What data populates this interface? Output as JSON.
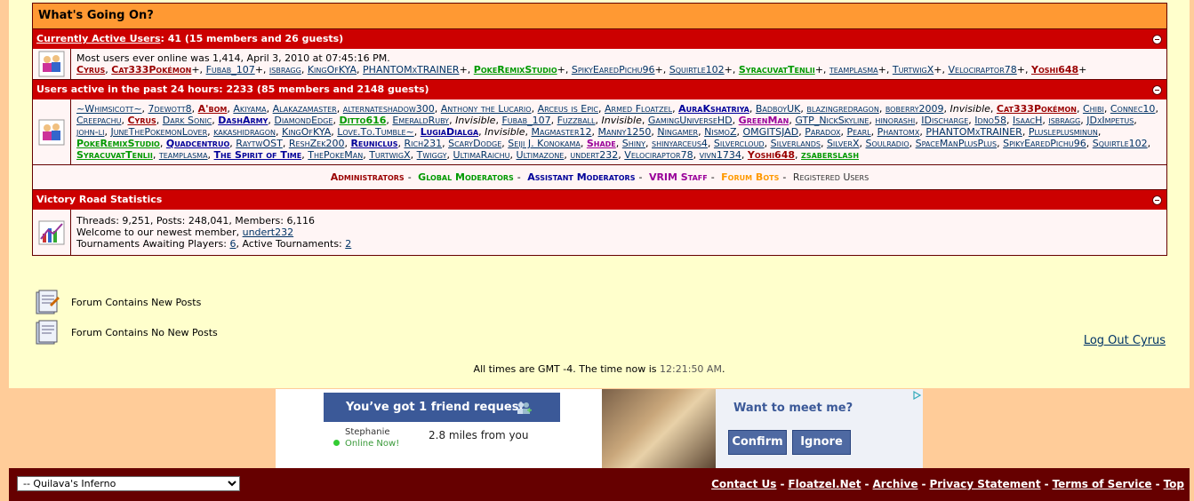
{
  "box_title": "What's Going On?",
  "active": {
    "heading_link": "Currently Active Users",
    "heading_rest": ": 41 (15 members and 26 guests)",
    "most_online": "Most users ever online was 1,414, April 3, 2010 at 07:45:16 PM.",
    "users": [
      {
        "name": "Cyrus",
        "cls": "u-red",
        "plus": ","
      },
      {
        "name": "Cat333Pokémon",
        "cls": "u-red",
        "plus": "+,"
      },
      {
        "name": "Fubab_107",
        "cls": "",
        "plus": "+,"
      },
      {
        "name": "isbragg",
        "cls": "",
        "plus": ","
      },
      {
        "name": "KingOfKYA",
        "cls": "",
        "plus": ","
      },
      {
        "name": "PHANTOMxTRAINER",
        "cls": "",
        "plus": "+,"
      },
      {
        "name": "PokeRemixStudio",
        "cls": "u-green",
        "plus": "+,"
      },
      {
        "name": "SpikyEaredPichu96",
        "cls": "",
        "plus": "+,"
      },
      {
        "name": "Squirtle102",
        "cls": "",
        "plus": "+,"
      },
      {
        "name": "SyracuvatTenlii",
        "cls": "u-green",
        "plus": "+,"
      },
      {
        "name": "teamplasma",
        "cls": "",
        "plus": "+,"
      },
      {
        "name": "TurtwigX",
        "cls": "",
        "plus": "+,"
      },
      {
        "name": "Velociraptor78",
        "cls": "",
        "plus": "+,"
      },
      {
        "name": "Yoshi648",
        "cls": "u-red",
        "plus": "+"
      }
    ]
  },
  "past24": {
    "heading": "Users active in the past 24 hours: 2233 (85 members and 2148 guests)",
    "users": [
      {
        "name": "~Whimsicott~",
        "cls": ""
      },
      {
        "name": "7dewott8",
        "cls": ""
      },
      {
        "name": "A'bom",
        "cls": "u-red"
      },
      {
        "name": "Akiyama",
        "cls": ""
      },
      {
        "name": "Alakazamaster",
        "cls": ""
      },
      {
        "name": "alternateshadow300",
        "cls": ""
      },
      {
        "name": "Anthony the Lucario",
        "cls": ""
      },
      {
        "name": "Arceus is Epic",
        "cls": ""
      },
      {
        "name": "Armed Floatzel",
        "cls": ""
      },
      {
        "name": "AuraKshatriya",
        "cls": "u-blue"
      },
      {
        "name": "BadboyUK",
        "cls": ""
      },
      {
        "name": "blazingredragon",
        "cls": ""
      },
      {
        "name": "boberry2009",
        "cls": ""
      },
      {
        "name": "Invisible",
        "cls": "inv"
      },
      {
        "name": "Cat333Pokémon",
        "cls": "u-red"
      },
      {
        "name": "Chibi",
        "cls": ""
      },
      {
        "name": "Connec10",
        "cls": ""
      },
      {
        "name": "Creepachu",
        "cls": ""
      },
      {
        "name": "Cyrus",
        "cls": "u-red"
      },
      {
        "name": "Dark Sonic",
        "cls": ""
      },
      {
        "name": "DashArmy",
        "cls": "u-blue"
      },
      {
        "name": "DiamondEdge",
        "cls": ""
      },
      {
        "name": "Ditto616",
        "cls": "u-green"
      },
      {
        "name": "EmeraldRuby",
        "cls": ""
      },
      {
        "name": "Invisible",
        "cls": "inv"
      },
      {
        "name": "Fubab_107",
        "cls": ""
      },
      {
        "name": "Fuzzball",
        "cls": ""
      },
      {
        "name": "Invisible",
        "cls": "inv"
      },
      {
        "name": "GamingUniverseHD",
        "cls": ""
      },
      {
        "name": "GreenMan",
        "cls": "u-purple"
      },
      {
        "name": "GTP_NickSkyline",
        "cls": ""
      },
      {
        "name": "hinorashi",
        "cls": ""
      },
      {
        "name": "IDischarge",
        "cls": ""
      },
      {
        "name": "Idno58",
        "cls": ""
      },
      {
        "name": "IsaacH",
        "cls": ""
      },
      {
        "name": "isbragg",
        "cls": ""
      },
      {
        "name": "JDxImpetus",
        "cls": ""
      },
      {
        "name": "john-li",
        "cls": ""
      },
      {
        "name": "JuneThePokemonLover",
        "cls": ""
      },
      {
        "name": "kakashidragon",
        "cls": ""
      },
      {
        "name": "KingOfKYA",
        "cls": ""
      },
      {
        "name": "Love.To.Tumble~",
        "cls": ""
      },
      {
        "name": "LugiaDialga",
        "cls": "u-blue"
      },
      {
        "name": "Invisible",
        "cls": "inv"
      },
      {
        "name": "Magmaster12",
        "cls": ""
      },
      {
        "name": "Manny1250",
        "cls": ""
      },
      {
        "name": "Ningamer",
        "cls": ""
      },
      {
        "name": "NismoZ",
        "cls": ""
      },
      {
        "name": "OMGITSJAD",
        "cls": ""
      },
      {
        "name": "Paradox",
        "cls": ""
      },
      {
        "name": "Pearl",
        "cls": ""
      },
      {
        "name": "Phantomx",
        "cls": ""
      },
      {
        "name": "PHANTOMxTRAINER",
        "cls": ""
      },
      {
        "name": "Plusleplusminun",
        "cls": ""
      },
      {
        "name": "PokeRemixStudio",
        "cls": "u-green"
      },
      {
        "name": "Quadcentruo",
        "cls": "u-blue"
      },
      {
        "name": "RaytwOST",
        "cls": ""
      },
      {
        "name": "ReshZek200",
        "cls": ""
      },
      {
        "name": "Reuniclus",
        "cls": "u-blue"
      },
      {
        "name": "Rich231",
        "cls": ""
      },
      {
        "name": "ScaryDodge",
        "cls": ""
      },
      {
        "name": "Seiji J. Konokama",
        "cls": ""
      },
      {
        "name": "Shade",
        "cls": "u-purple"
      },
      {
        "name": "Shiny",
        "cls": ""
      },
      {
        "name": "shinyarceus4",
        "cls": ""
      },
      {
        "name": "Silvercloud",
        "cls": ""
      },
      {
        "name": "Silverlands",
        "cls": ""
      },
      {
        "name": "SilverX",
        "cls": ""
      },
      {
        "name": "Soulradio",
        "cls": ""
      },
      {
        "name": "SpaceManPlusPlus",
        "cls": ""
      },
      {
        "name": "SpikyEaredPichu96",
        "cls": ""
      },
      {
        "name": "Squirtle102",
        "cls": ""
      },
      {
        "name": "SyracuvatTenlii",
        "cls": "u-green"
      },
      {
        "name": "teamplasma",
        "cls": ""
      },
      {
        "name": "The Spirit of Time",
        "cls": "u-blue"
      },
      {
        "name": "ThePokeMan",
        "cls": ""
      },
      {
        "name": "TurtwigX",
        "cls": ""
      },
      {
        "name": "Twiggy",
        "cls": ""
      },
      {
        "name": "UltimaRaichu",
        "cls": ""
      },
      {
        "name": "Ultimazone",
        "cls": ""
      },
      {
        "name": "undert232",
        "cls": ""
      },
      {
        "name": "Velociraptor78",
        "cls": ""
      },
      {
        "name": "vivn1734",
        "cls": ""
      },
      {
        "name": "Yoshi648",
        "cls": "u-red"
      },
      {
        "name": "zsaberslash",
        "cls": "u-green"
      }
    ]
  },
  "legend": {
    "admins": "Administrators",
    "gmods": "Global Moderators",
    "amods": "Assistant Moderators",
    "vrim": "VRIM Staff",
    "bots": "Forum Bots",
    "registered": "Registered Users",
    "sep": "-"
  },
  "stats": {
    "heading": "Victory Road Statistics",
    "line1": "Threads: 9,251, Posts: 248,041, Members: 6,116",
    "welcome_prefix": "Welcome to our newest member, ",
    "newest_member": "undert232",
    "tourn_prefix": "Tournaments Awaiting Players: ",
    "tourn_awaiting": "6",
    "tourn_mid": ", Active Tournaments: ",
    "tourn_active": "2"
  },
  "forum_legend": {
    "new_posts": "Forum Contains New Posts",
    "no_new_posts": "Forum Contains No New Posts"
  },
  "logout": "Log Out Cyrus",
  "time": {
    "prefix": "All times are GMT -4. The time now is ",
    "now": "12:21:50 AM",
    "suffix": "."
  },
  "ad": {
    "headline": "You’ve got 1 friend request",
    "person": "Stephanie",
    "status": "Online Now!",
    "distance": "2.8 miles from you",
    "cta": "Want to meet me?",
    "confirm": "Confirm",
    "ignore": "Ignore"
  },
  "footer": {
    "style_select": "-- Quilava's Inferno",
    "links": [
      "Contact Us",
      "Floatzel.Net",
      "Archive",
      "Privacy Statement",
      "Terms of Service",
      "Top"
    ]
  },
  "colors": {
    "header_orange": "#ff9933",
    "section_red": "#cc0000",
    "page_bg": "#ffffcc",
    "outer_bg": "#ffcc99",
    "footer_bg": "#660000"
  }
}
